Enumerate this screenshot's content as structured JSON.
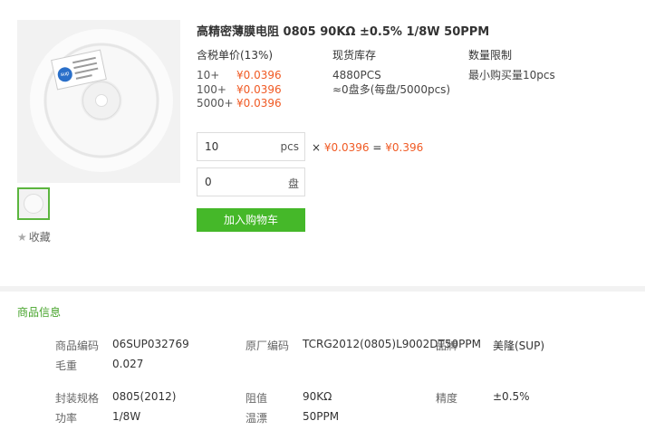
{
  "product": {
    "title": "高精密薄膜电阻 0805 90KΩ ±0.5% 1/8W 50PPM",
    "image_logo": "sup",
    "favorite_label": "收藏"
  },
  "pricing": {
    "header_price": "含税单价(13%)",
    "header_stock": "现货库存",
    "header_limit": "数量限制",
    "tiers": [
      {
        "qty": "10+",
        "price": "¥0.0396"
      },
      {
        "qty": "100+",
        "price": "¥0.0396"
      },
      {
        "qty": "5000+",
        "price": "¥0.0396"
      }
    ],
    "stock": "4880PCS",
    "stock_reels": "≈0盘多(每盘/5000pcs)",
    "limit": "最小购买量10pcs"
  },
  "order": {
    "qty_value": "10",
    "qty_unit": "pcs",
    "reel_value": "0",
    "reel_unit": "盘",
    "times": "×",
    "unit_price": "¥0.0396",
    "equals": "=",
    "total": "¥0.396",
    "add_to_cart": "加入购物车"
  },
  "info": {
    "section_title": "商品信息",
    "specs": {
      "code_label": "商品编码",
      "code_value": "06SUP032769",
      "mfr_code_label": "原厂编码",
      "mfr_code_value": "TCRG2012(0805)L9002DT50PPM",
      "brand_label": "品牌",
      "brand_value": "美隆(SUP)",
      "weight_label": "毛重",
      "weight_value": "0.027",
      "package_label": "封装规格",
      "package_value": "0805(2012)",
      "resistance_label": "阻值",
      "resistance_value": "90KΩ",
      "precision_label": "精度",
      "precision_value": "±0.5%",
      "power_label": "功率",
      "power_value": "1/8W",
      "tempco_label": "温漂",
      "tempco_value": "50PPM"
    }
  },
  "colors": {
    "accent_green": "#45b829",
    "price_red": "#f05a24"
  }
}
